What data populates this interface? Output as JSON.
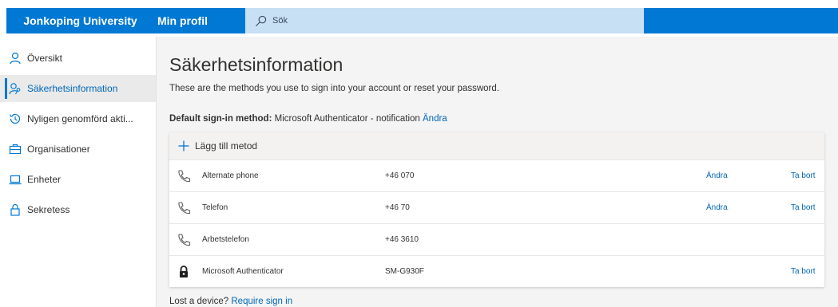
{
  "header": {
    "org_name": "Jonkoping University",
    "app_name": "Min profil",
    "search_placeholder": "Sök",
    "accent": "#0078d4"
  },
  "sidebar": {
    "items": [
      {
        "label": "Översikt",
        "icon": "person-icon"
      },
      {
        "label": "Säkerhetsinformation",
        "icon": "person-key-icon",
        "active": true
      },
      {
        "label": "Nyligen genomförd akti...",
        "icon": "history-icon"
      },
      {
        "label": "Organisationer",
        "icon": "briefcase-icon"
      },
      {
        "label": "Enheter",
        "icon": "laptop-icon"
      },
      {
        "label": "Sekretess",
        "icon": "lock-icon"
      }
    ]
  },
  "main": {
    "title": "Säkerhetsinformation",
    "subtitle": "These are the methods you use to sign into your account or reset your password.",
    "default_label": "Default sign-in method:",
    "default_value": "Microsoft Authenticator - notification",
    "default_change": "Ändra",
    "add_method": "Lägg till metod",
    "methods": [
      {
        "icon": "phone-icon",
        "name": "Alternate phone",
        "value": "+46 070",
        "change": "Ändra",
        "remove": "Ta bort"
      },
      {
        "icon": "phone-icon",
        "name": "Telefon",
        "value": "+46 70",
        "change": "Ändra",
        "remove": "Ta bort"
      },
      {
        "icon": "phone-icon",
        "name": "Arbetstelefon",
        "value": "+46 3610",
        "change": "",
        "remove": ""
      },
      {
        "icon": "authenticator-icon",
        "name": "Microsoft Authenticator",
        "value": "SM-G930F",
        "change": "",
        "remove": "Ta bort"
      }
    ],
    "lost_text": "Lost a device?",
    "lost_link": "Require sign in"
  }
}
